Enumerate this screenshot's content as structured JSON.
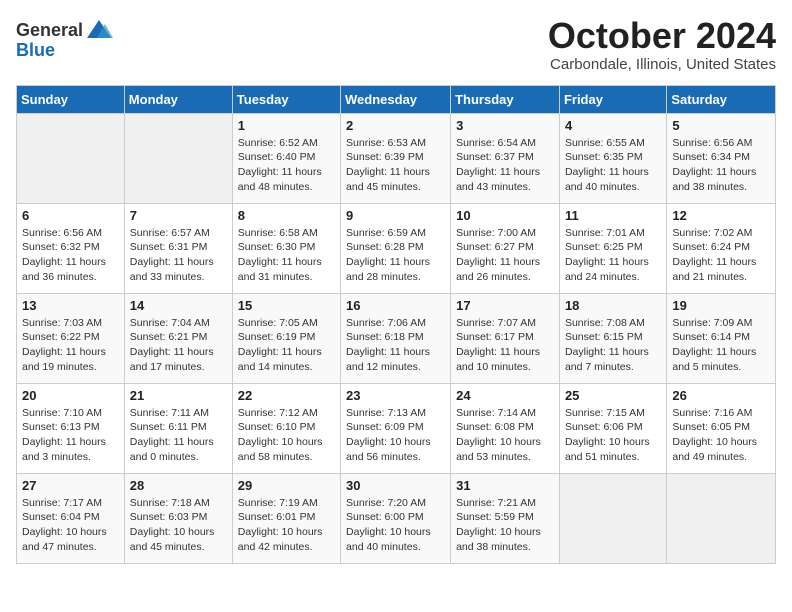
{
  "header": {
    "logo_general": "General",
    "logo_blue": "Blue",
    "month": "October 2024",
    "location": "Carbondale, Illinois, United States"
  },
  "weekdays": [
    "Sunday",
    "Monday",
    "Tuesday",
    "Wednesday",
    "Thursday",
    "Friday",
    "Saturday"
  ],
  "weeks": [
    [
      {
        "day": "",
        "info": ""
      },
      {
        "day": "",
        "info": ""
      },
      {
        "day": "1",
        "sunrise": "6:52 AM",
        "sunset": "6:40 PM",
        "daylight": "11 hours and 48 minutes."
      },
      {
        "day": "2",
        "sunrise": "6:53 AM",
        "sunset": "6:39 PM",
        "daylight": "11 hours and 45 minutes."
      },
      {
        "day": "3",
        "sunrise": "6:54 AM",
        "sunset": "6:37 PM",
        "daylight": "11 hours and 43 minutes."
      },
      {
        "day": "4",
        "sunrise": "6:55 AM",
        "sunset": "6:35 PM",
        "daylight": "11 hours and 40 minutes."
      },
      {
        "day": "5",
        "sunrise": "6:56 AM",
        "sunset": "6:34 PM",
        "daylight": "11 hours and 38 minutes."
      }
    ],
    [
      {
        "day": "6",
        "sunrise": "6:56 AM",
        "sunset": "6:32 PM",
        "daylight": "11 hours and 36 minutes."
      },
      {
        "day": "7",
        "sunrise": "6:57 AM",
        "sunset": "6:31 PM",
        "daylight": "11 hours and 33 minutes."
      },
      {
        "day": "8",
        "sunrise": "6:58 AM",
        "sunset": "6:30 PM",
        "daylight": "11 hours and 31 minutes."
      },
      {
        "day": "9",
        "sunrise": "6:59 AM",
        "sunset": "6:28 PM",
        "daylight": "11 hours and 28 minutes."
      },
      {
        "day": "10",
        "sunrise": "7:00 AM",
        "sunset": "6:27 PM",
        "daylight": "11 hours and 26 minutes."
      },
      {
        "day": "11",
        "sunrise": "7:01 AM",
        "sunset": "6:25 PM",
        "daylight": "11 hours and 24 minutes."
      },
      {
        "day": "12",
        "sunrise": "7:02 AM",
        "sunset": "6:24 PM",
        "daylight": "11 hours and 21 minutes."
      }
    ],
    [
      {
        "day": "13",
        "sunrise": "7:03 AM",
        "sunset": "6:22 PM",
        "daylight": "11 hours and 19 minutes."
      },
      {
        "day": "14",
        "sunrise": "7:04 AM",
        "sunset": "6:21 PM",
        "daylight": "11 hours and 17 minutes."
      },
      {
        "day": "15",
        "sunrise": "7:05 AM",
        "sunset": "6:19 PM",
        "daylight": "11 hours and 14 minutes."
      },
      {
        "day": "16",
        "sunrise": "7:06 AM",
        "sunset": "6:18 PM",
        "daylight": "11 hours and 12 minutes."
      },
      {
        "day": "17",
        "sunrise": "7:07 AM",
        "sunset": "6:17 PM",
        "daylight": "11 hours and 10 minutes."
      },
      {
        "day": "18",
        "sunrise": "7:08 AM",
        "sunset": "6:15 PM",
        "daylight": "11 hours and 7 minutes."
      },
      {
        "day": "19",
        "sunrise": "7:09 AM",
        "sunset": "6:14 PM",
        "daylight": "11 hours and 5 minutes."
      }
    ],
    [
      {
        "day": "20",
        "sunrise": "7:10 AM",
        "sunset": "6:13 PM",
        "daylight": "11 hours and 3 minutes."
      },
      {
        "day": "21",
        "sunrise": "7:11 AM",
        "sunset": "6:11 PM",
        "daylight": "11 hours and 0 minutes."
      },
      {
        "day": "22",
        "sunrise": "7:12 AM",
        "sunset": "6:10 PM",
        "daylight": "10 hours and 58 minutes."
      },
      {
        "day": "23",
        "sunrise": "7:13 AM",
        "sunset": "6:09 PM",
        "daylight": "10 hours and 56 minutes."
      },
      {
        "day": "24",
        "sunrise": "7:14 AM",
        "sunset": "6:08 PM",
        "daylight": "10 hours and 53 minutes."
      },
      {
        "day": "25",
        "sunrise": "7:15 AM",
        "sunset": "6:06 PM",
        "daylight": "10 hours and 51 minutes."
      },
      {
        "day": "26",
        "sunrise": "7:16 AM",
        "sunset": "6:05 PM",
        "daylight": "10 hours and 49 minutes."
      }
    ],
    [
      {
        "day": "27",
        "sunrise": "7:17 AM",
        "sunset": "6:04 PM",
        "daylight": "10 hours and 47 minutes."
      },
      {
        "day": "28",
        "sunrise": "7:18 AM",
        "sunset": "6:03 PM",
        "daylight": "10 hours and 45 minutes."
      },
      {
        "day": "29",
        "sunrise": "7:19 AM",
        "sunset": "6:01 PM",
        "daylight": "10 hours and 42 minutes."
      },
      {
        "day": "30",
        "sunrise": "7:20 AM",
        "sunset": "6:00 PM",
        "daylight": "10 hours and 40 minutes."
      },
      {
        "day": "31",
        "sunrise": "7:21 AM",
        "sunset": "5:59 PM",
        "daylight": "10 hours and 38 minutes."
      },
      {
        "day": "",
        "info": ""
      },
      {
        "day": "",
        "info": ""
      }
    ]
  ],
  "labels": {
    "sunrise": "Sunrise:",
    "sunset": "Sunset:",
    "daylight": "Daylight:"
  }
}
